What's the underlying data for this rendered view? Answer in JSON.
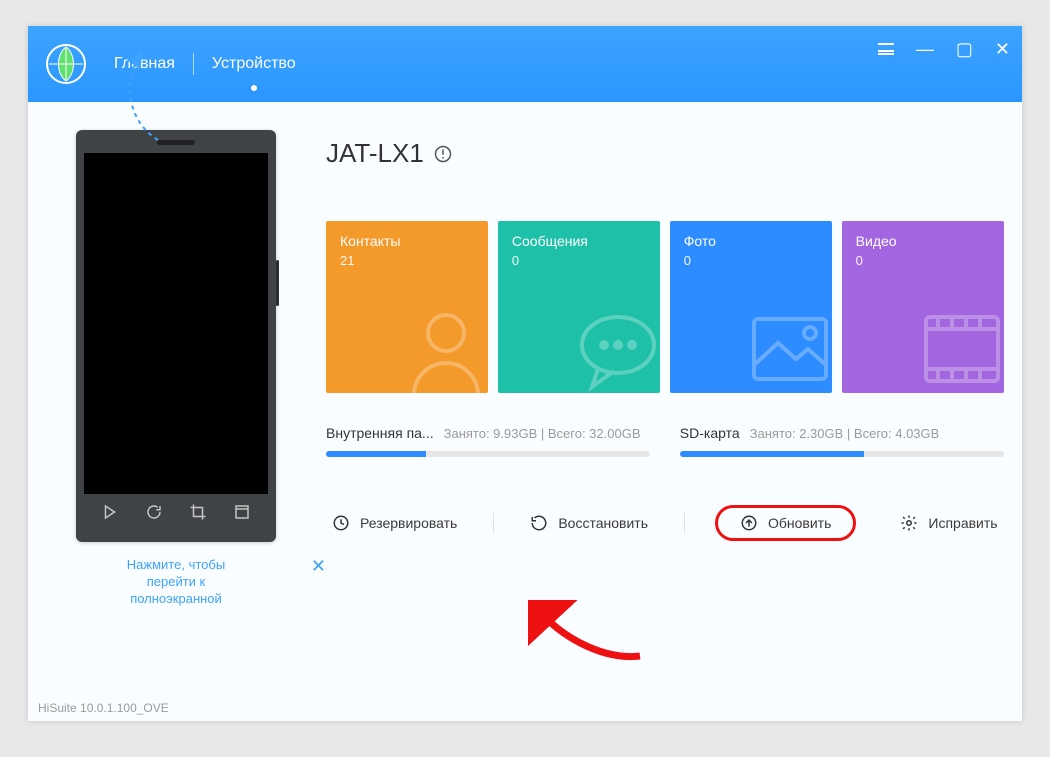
{
  "app_version": "HiSuite 10.0.1.100_OVE",
  "header": {
    "tab_home": "Главная",
    "tab_device": "Устройство"
  },
  "device": {
    "name": "JAT-LX1"
  },
  "tiles": [
    {
      "label": "Контакты",
      "count": "21",
      "color": "#f39a2b"
    },
    {
      "label": "Сообщения",
      "count": "0",
      "color": "#1ec0a8"
    },
    {
      "label": "Фото",
      "count": "0",
      "color": "#2d8cff"
    },
    {
      "label": "Видео",
      "count": "0",
      "color": "#a465e0"
    }
  ],
  "storage": {
    "internal": {
      "label": "Внутренняя па...",
      "used": "Занято: 9.93GB",
      "total": "Всего: 32.00GB",
      "percent": 31
    },
    "sd": {
      "label": "SD-карта",
      "used": "Занято: 2.30GB",
      "total": "Всего: 4.03GB",
      "percent": 57
    }
  },
  "actions": {
    "backup": "Резервировать",
    "restore": "Восстановить",
    "update": "Обновить",
    "repair": "Исправить"
  },
  "hint": {
    "text_line1": "Нажмите, чтобы",
    "text_line2": "перейти к",
    "text_line3": "полноэкранной"
  }
}
